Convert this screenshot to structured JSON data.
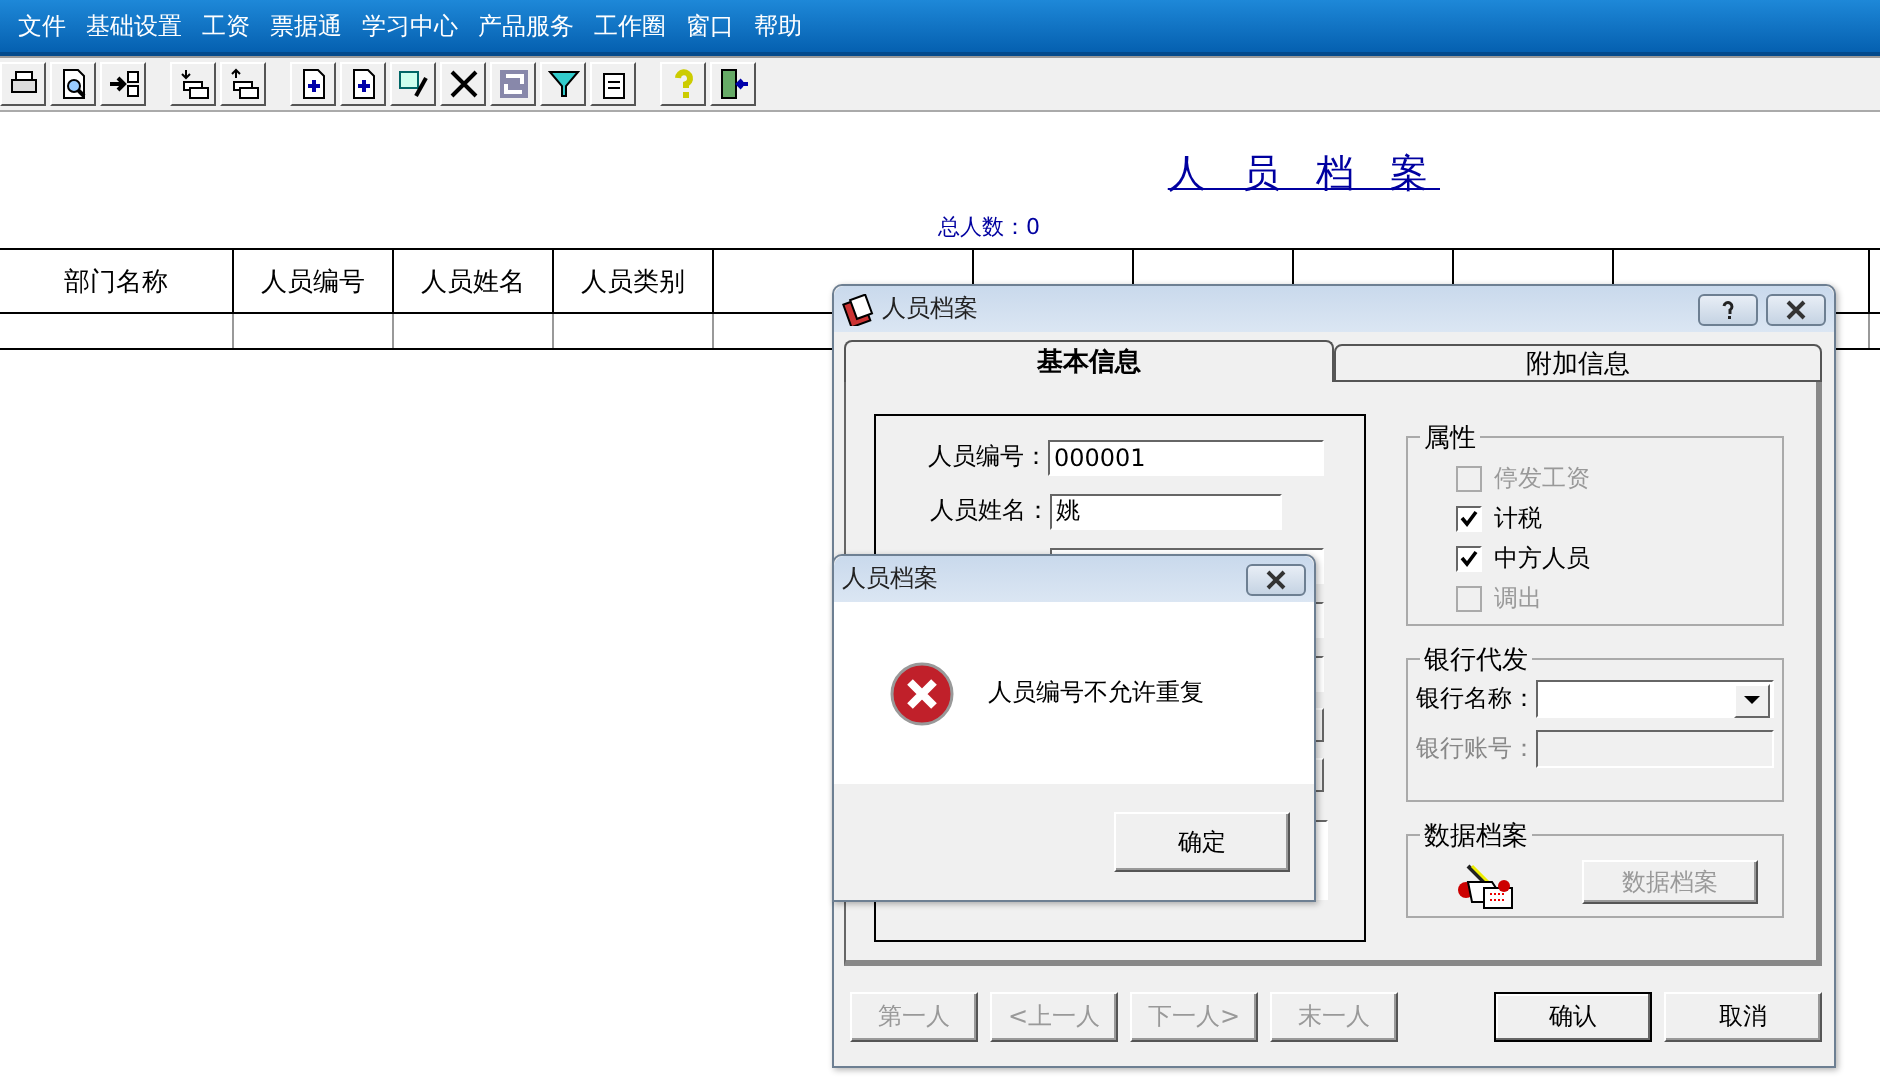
{
  "menu": [
    {
      "label": "文件"
    },
    {
      "label": "基础设置"
    },
    {
      "label": "工资"
    },
    {
      "label": "票据通"
    },
    {
      "label": "学习中心"
    },
    {
      "label": "产品服务"
    },
    {
      "label": "工作圈"
    },
    {
      "label": "窗口"
    },
    {
      "label": "帮助"
    }
  ],
  "report": {
    "title": "人 员 档 案",
    "total": "总人数：0",
    "columns": [
      "部门名称",
      "人员编号",
      "人员姓名",
      "人员类别"
    ]
  },
  "dialog": {
    "title": "人员档案",
    "tabs": [
      {
        "label": "基本信息",
        "selected": true
      },
      {
        "label": "附加信息",
        "selected": false
      }
    ],
    "fields": [
      {
        "label": "人员编号：",
        "value": "000001"
      },
      {
        "label": "人员姓名：",
        "value": "姚"
      }
    ],
    "attributes": {
      "title": "属性",
      "items": [
        {
          "label": "停发工资",
          "checked": false,
          "disabled": true
        },
        {
          "label": "计税",
          "checked": true,
          "disabled": false
        },
        {
          "label": "中方人员",
          "checked": true,
          "disabled": false
        },
        {
          "label": "调出",
          "checked": false,
          "disabled": true
        }
      ]
    },
    "bank": {
      "title": "银行代发",
      "fields": [
        {
          "label": "银行名称：",
          "kind": "dropdown",
          "disabled": false
        },
        {
          "label": "银行账号：",
          "kind": "text",
          "disabled": true
        }
      ]
    },
    "archive": {
      "title": "数据档案",
      "button": "数据档案",
      "disabled": true
    },
    "nav": [
      {
        "label": "第一人",
        "disabled": true
      },
      {
        "label": "<上一人",
        "disabled": true
      },
      {
        "label": "下一人>",
        "disabled": true
      },
      {
        "label": "末一人",
        "disabled": true
      }
    ],
    "actions": [
      {
        "label": "确认"
      },
      {
        "label": "取消"
      }
    ]
  },
  "error": {
    "title": "人员档案",
    "message": "人员编号不允许重复",
    "button": "确定"
  }
}
